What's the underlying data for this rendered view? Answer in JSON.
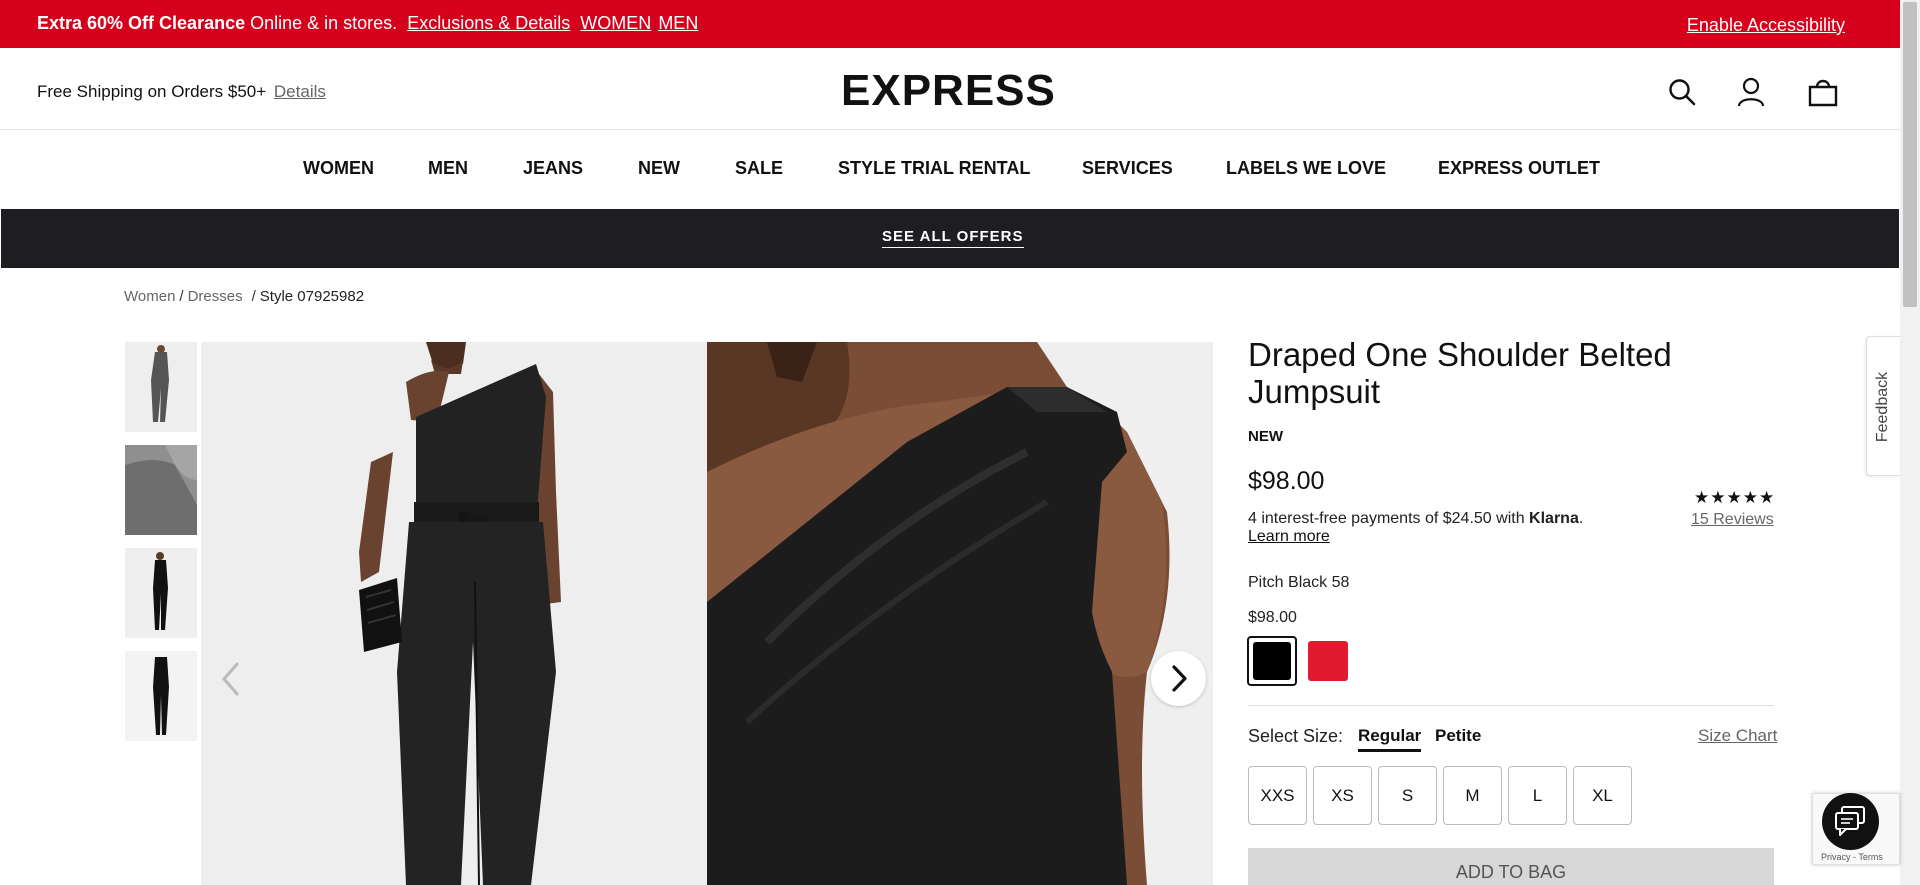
{
  "promo": {
    "headline": "Extra 60% Off Clearance",
    "text": " Online & in stores.",
    "link_details": "Exclusions & Details",
    "link_women": "WOMEN",
    "link_men": "MEN",
    "accessibility": "Enable Accessibility"
  },
  "header": {
    "shipping_text": "Free Shipping on Orders $50+",
    "shipping_link": "Details",
    "logo": "EXPRESS",
    "icons": [
      "search-icon",
      "account-icon",
      "bag-icon"
    ]
  },
  "nav": {
    "items": [
      {
        "label": "WOMEN"
      },
      {
        "label": "MEN"
      },
      {
        "label": "JEANS"
      },
      {
        "label": "NEW"
      },
      {
        "label": "SALE"
      },
      {
        "label": "STYLE TRIAL RENTAL"
      },
      {
        "label": "SERVICES"
      },
      {
        "label": "LABELS WE LOVE"
      },
      {
        "label": "EXPRESS OUTLET"
      }
    ]
  },
  "offers": {
    "label": "SEE ALL OFFERS"
  },
  "breadcrumb": {
    "items": [
      "Women",
      "Dresses"
    ],
    "separator": "/",
    "current": "Style 07925982"
  },
  "product": {
    "title": "Draped One Shoulder Belted Jumpsuit",
    "badge": "NEW",
    "price": "$98.00",
    "klarna_text": "4 interest-free payments of $24.50 with",
    "klarna_brand": "Klarna",
    "klarna_dot": ".",
    "learn_more": "Learn more",
    "stars": "★★★★★",
    "rating": 5,
    "reviews": "15 Reviews",
    "color_name": "Pitch Black 58",
    "color_price": "$98.00",
    "swatches": [
      {
        "name": "Pitch Black 58",
        "color": "#000000",
        "selected": true
      },
      {
        "name": "Red",
        "color": "#e11a30",
        "selected": false
      }
    ],
    "size_label": "Select Size:",
    "fit_options": [
      "Regular",
      "Petite"
    ],
    "fit_selected": "Regular",
    "size_chart": "Size Chart",
    "sizes": [
      "XXS",
      "XS",
      "S",
      "M",
      "L",
      "XL"
    ],
    "add_to_bag": "ADD TO BAG"
  },
  "feedback": {
    "label": "Feedback"
  },
  "recaptcha": {
    "text": "Privacy - Terms"
  },
  "colors": {
    "promo_red": "#d6001c",
    "offers_bar": "#1d1d22"
  }
}
